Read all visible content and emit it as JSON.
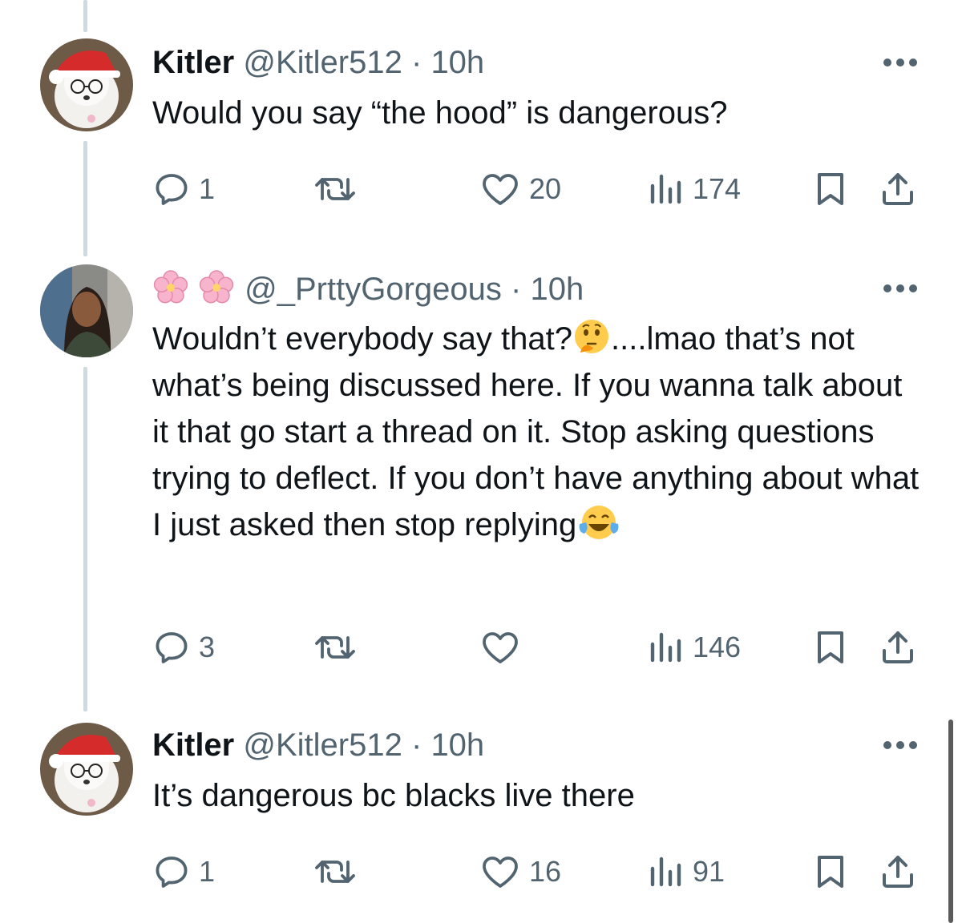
{
  "tweets": [
    {
      "display_name": "Kitler",
      "handle": "@Kitler512",
      "separator": "·",
      "time": "10h",
      "text": "Would you say “the hood” is dangerous?",
      "replies": "1",
      "retweets": "",
      "likes": "20",
      "views": "174"
    },
    {
      "display_name": "🌸🌸",
      "handle": "@_PrttyGorgeous",
      "separator": "·",
      "time": "10h",
      "text_part1": "Wouldn’t everybody say that?",
      "text_part2": "....lmao that’s not what’s being discussed here. If you wanna talk about it that go start a thread on it. Stop asking questions trying to deflect. If you don’t have anything about what I just asked then stop replying",
      "emoji_1": "thinking-face-emoji",
      "emoji_2": "tears-of-joy-emoji",
      "replies": "3",
      "retweets": "",
      "likes": "",
      "views": "146"
    },
    {
      "display_name": "Kitler",
      "handle": "@Kitler512",
      "separator": "·",
      "time": "10h",
      "text": "It’s dangerous bc blacks live there",
      "replies": "1",
      "retweets": "",
      "likes": "16",
      "views": "91"
    }
  ],
  "icons": {
    "reply": "reply-icon",
    "retweet": "retweet-icon",
    "like": "heart-icon",
    "views": "views-icon",
    "bookmark": "bookmark-icon",
    "share": "share-icon",
    "more": "more-icon"
  },
  "colors": {
    "text": "#0f1419",
    "secondary": "#536471",
    "thread_line": "#cfd9de"
  }
}
